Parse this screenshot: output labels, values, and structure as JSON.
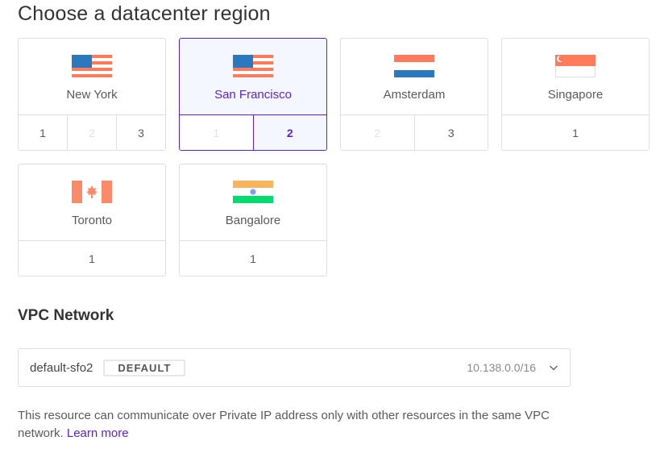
{
  "page": {
    "title": "Choose a datacenter region"
  },
  "regions": [
    {
      "name": "New York",
      "flag": "us-flag-icon",
      "selected": false,
      "datacenters": [
        {
          "label": "1",
          "state": "available"
        },
        {
          "label": "2",
          "state": "disabled"
        },
        {
          "label": "3",
          "state": "available"
        }
      ]
    },
    {
      "name": "San Francisco",
      "flag": "us-flag-icon",
      "selected": true,
      "datacenters": [
        {
          "label": "1",
          "state": "disabled"
        },
        {
          "label": "2",
          "state": "active"
        }
      ]
    },
    {
      "name": "Amsterdam",
      "flag": "netherlands-flag-icon",
      "selected": false,
      "datacenters": [
        {
          "label": "2",
          "state": "disabled"
        },
        {
          "label": "3",
          "state": "available"
        }
      ]
    },
    {
      "name": "Singapore",
      "flag": "singapore-flag-icon",
      "selected": false,
      "datacenters": [
        {
          "label": "1",
          "state": "available"
        }
      ]
    },
    {
      "name": "Toronto",
      "flag": "canada-flag-icon",
      "selected": false,
      "datacenters": [
        {
          "label": "1",
          "state": "available"
        }
      ]
    },
    {
      "name": "Bangalore",
      "flag": "india-flag-icon",
      "selected": false,
      "datacenters": [
        {
          "label": "1",
          "state": "available"
        }
      ]
    }
  ],
  "vpc": {
    "heading": "VPC Network",
    "selected_name": "default-sfo2",
    "badge": "DEFAULT",
    "ip_range": "10.138.0.0/16",
    "chevron": "chevron-down-icon",
    "help_text": "This resource can communicate over Private IP address only with other resources in the same VPC network.",
    "learn_more": "Learn more"
  },
  "colors": {
    "accent": "#5b1fd9",
    "selected_bg": "#f4f7ff",
    "border": "#dfdfdf"
  }
}
